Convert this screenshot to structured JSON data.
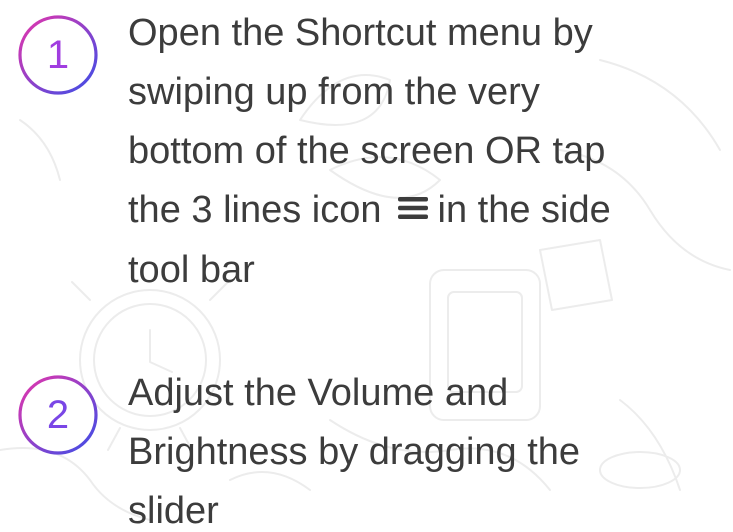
{
  "steps": [
    {
      "number": "1",
      "line1": "Open the Shortcut menu by",
      "line2": "swiping up from the very",
      "line3": "bottom of the screen OR tap",
      "line4_before_icon": "the 3 lines icon",
      "inline_icon": "menu-icon",
      "line4_after_icon": "in the side",
      "line5": "tool bar"
    },
    {
      "number": "2",
      "line1": "Adjust the Volume and",
      "line2": "Brightness by dragging the",
      "line3": "slider"
    }
  ],
  "colors": {
    "text": "#3c3c3c",
    "badge_gradient_start": "#e535ab",
    "badge_gradient_end": "#3b4ee8",
    "background_doodles": "#ececec"
  }
}
